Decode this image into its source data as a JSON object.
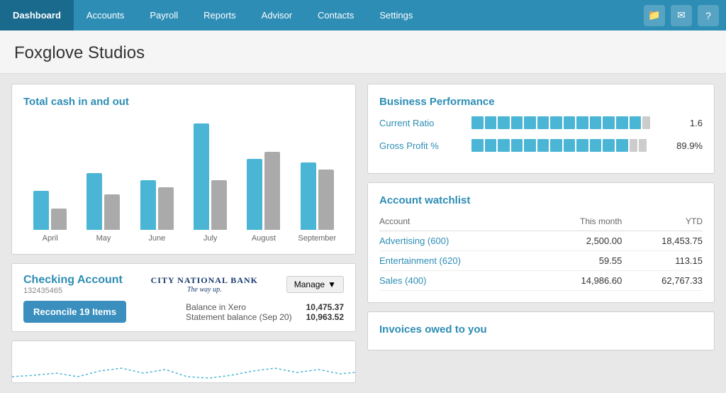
{
  "nav": {
    "items": [
      {
        "label": "Dashboard",
        "active": true
      },
      {
        "label": "Accounts"
      },
      {
        "label": "Payroll"
      },
      {
        "label": "Reports"
      },
      {
        "label": "Advisor"
      },
      {
        "label": "Contacts"
      },
      {
        "label": "Settings"
      }
    ],
    "icons": [
      "folder-icon",
      "mail-icon",
      "help-icon"
    ]
  },
  "page": {
    "title": "Foxglove Studios"
  },
  "cash_chart": {
    "title": "Total cash in and out",
    "months": [
      "April",
      "May",
      "June",
      "July",
      "August",
      "September"
    ],
    "bars": [
      {
        "blue": 55,
        "gray": 30
      },
      {
        "blue": 80,
        "gray": 50
      },
      {
        "blue": 70,
        "gray": 60
      },
      {
        "blue": 150,
        "gray": 70
      },
      {
        "blue": 100,
        "gray": 110
      },
      {
        "blue": 95,
        "gray": 85
      }
    ]
  },
  "checking": {
    "title": "Checking Account",
    "account_number": "132435465",
    "bank_name": "City National Bank",
    "bank_tagline": "The way up.",
    "manage_label": "Manage",
    "reconcile_label": "Reconcile 19 Items",
    "balance_in_xero_label": "Balance in Xero",
    "balance_in_xero_value": "10,475.37",
    "statement_balance_label": "Statement balance (Sep 20)",
    "statement_balance_value": "10,963.52"
  },
  "business_performance": {
    "title": "Business Performance",
    "metrics": [
      {
        "label": "Current Ratio",
        "value": "1.6",
        "segments": 14,
        "filled": 13
      },
      {
        "label": "Gross Profit %",
        "value": "89.9%",
        "segments": 14,
        "filled": 12
      }
    ]
  },
  "watchlist": {
    "title": "Account watchlist",
    "columns": [
      "Account",
      "This month",
      "YTD"
    ],
    "rows": [
      {
        "account": "Advertising (600)",
        "this_month": "2,500.00",
        "ytd": "18,453.75"
      },
      {
        "account": "Entertainment (620)",
        "this_month": "59.55",
        "ytd": "113.15"
      },
      {
        "account": "Sales (400)",
        "this_month": "14,986.60",
        "ytd": "62,767.33"
      }
    ]
  },
  "invoices": {
    "title": "Invoices owed to you"
  }
}
